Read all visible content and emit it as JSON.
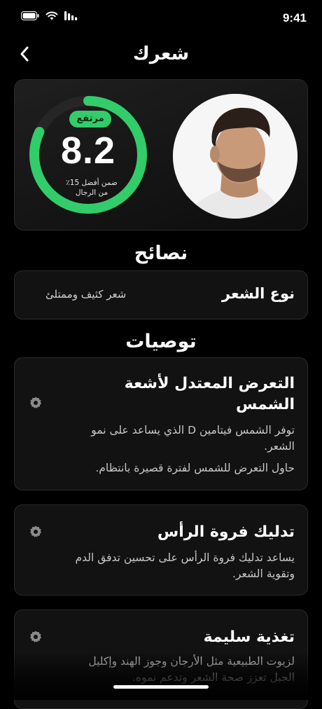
{
  "status": {
    "time": "9:41"
  },
  "nav": {
    "title": "شعرك"
  },
  "score": {
    "badge": "مرتفع",
    "value": "8.2",
    "caption": "ضمن أفضل 15٪ من الرجال",
    "level": 0.82,
    "ring_color": "#32cc6a"
  },
  "tips": {
    "title": "نصائح",
    "hair_type_label": "نوع الشعر",
    "hair_type_value": "شعر كثيف وممتلئ"
  },
  "recommendations": {
    "title": "توصيات",
    "items": [
      {
        "title_1": "التعرض المعتدل لأشعة",
        "title_2": "الشمس",
        "text_1": "توفر الشمس فيتامين D الذي يساعد على نمو",
        "text_2": "الشعر.",
        "text_3": "حاول التعرض للشمس لفترة قصيرة بانتظام."
      },
      {
        "title_1": "تدليك فروة الرأس",
        "text_1": "يساعد تدليك فروة الرأس على تحسين تدفق الدم",
        "text_2": "وتقوية الشعر."
      },
      {
        "title_1": "تغذية سليمة",
        "text_1": "لزيوت الطبيعية مثل الأرجان وجوز الهند وإكليل",
        "text_2": "الجبل تعزز صحة الشعر وتدعم نموه."
      }
    ]
  },
  "icons": {
    "back": "chevron-left-icon",
    "gear": "gear-icon",
    "battery": "battery-icon",
    "wifi": "wifi-icon",
    "signal": "signal-icon"
  }
}
